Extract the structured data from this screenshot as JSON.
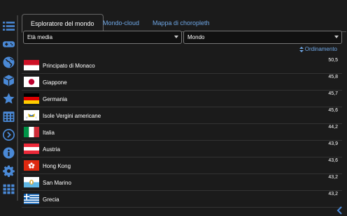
{
  "tabs": [
    {
      "label": "Esploratore del mondo",
      "active": true
    },
    {
      "label": "Mondo-cloud",
      "active": false
    },
    {
      "label": "Mappa di choropleth",
      "active": false
    }
  ],
  "filters": {
    "indicator": "Età media",
    "region": "Mondo"
  },
  "sort_label": "Ordinamento",
  "rows": [
    {
      "country": "Principato di Monaco",
      "value": "50,5",
      "flag": "monaco"
    },
    {
      "country": "Giappone",
      "value": "45,8",
      "flag": "japan"
    },
    {
      "country": "Germania",
      "value": "45,7",
      "flag": "germany"
    },
    {
      "country": "Isole Vergini americane",
      "value": "45,6",
      "flag": "usvi"
    },
    {
      "country": "Italia",
      "value": "44,2",
      "flag": "italy"
    },
    {
      "country": "Austria",
      "value": "43,9",
      "flag": "austria"
    },
    {
      "country": "Hong Kong",
      "value": "43,6",
      "flag": "hongkong"
    },
    {
      "country": "San Marino",
      "value": "43,2",
      "flag": "sanmarino"
    },
    {
      "country": "Grecia",
      "value": "43,2",
      "flag": "greece"
    }
  ],
  "sidebar_icons": [
    "list-icon",
    "gamepad-icon",
    "globe-icon",
    "cube-icon",
    "star-icon",
    "calendar-grid-icon",
    "chevron-right-circle-icon",
    "info-icon",
    "gear-icon",
    "apps-grid-icon"
  ],
  "colors": {
    "accent": "#4a89d6",
    "link": "#6fa7e6",
    "background": "#1b1b1b"
  }
}
